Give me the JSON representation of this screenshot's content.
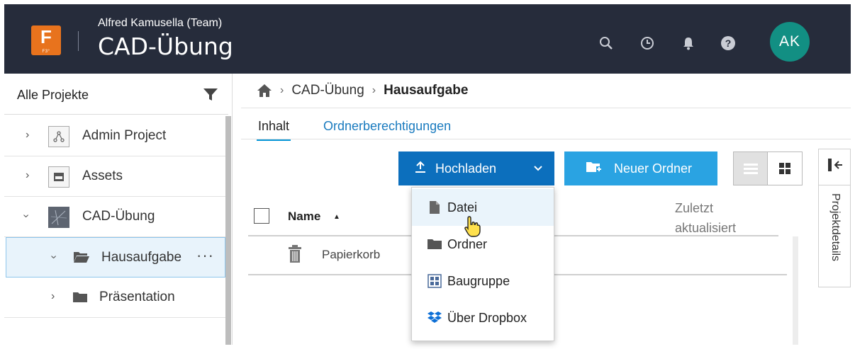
{
  "header": {
    "team_name": "Alfred Kamusella (Team)",
    "app_title": "CAD-Übung",
    "logo_letter": "F",
    "logo_sub": "F3°",
    "avatar_initials": "AK",
    "icons": [
      "search-icon",
      "history-icon",
      "bell-icon",
      "help-icon"
    ]
  },
  "sidebar": {
    "title": "Alle Projekte",
    "items": [
      {
        "label": "Admin Project",
        "icon": "project-admin-icon",
        "expanded": false
      },
      {
        "label": "Assets",
        "icon": "project-assets-icon",
        "expanded": false
      },
      {
        "label": "CAD-Übung",
        "icon": "project-cad-icon",
        "expanded": true
      },
      {
        "label": "Hausaufgabe",
        "icon": "folder-open-icon",
        "expanded": true,
        "selected": true,
        "more": "···"
      },
      {
        "label": "Präsentation",
        "icon": "folder-icon",
        "expanded": false
      }
    ]
  },
  "breadcrumb": {
    "items": [
      "CAD-Übung",
      "Hausaufgabe"
    ]
  },
  "tabs": {
    "content": "Inhalt",
    "permissions": "Ordnerberechtigungen"
  },
  "toolbar": {
    "upload_label": "Hochladen",
    "new_folder_label": "Neuer Ordner"
  },
  "table": {
    "col_name": "Name",
    "col_updated_line1": "Zuletzt",
    "col_updated_line2": "aktualisiert",
    "rows": [
      {
        "name": "Papierkorb",
        "icon": "trash-icon"
      }
    ]
  },
  "dropdown": {
    "items": [
      {
        "label": "Datei",
        "icon": "file-icon"
      },
      {
        "label": "Ordner",
        "icon": "folder-icon"
      },
      {
        "label": "Baugruppe",
        "icon": "assembly-icon"
      },
      {
        "label": "Über Dropbox",
        "icon": "dropbox-icon"
      }
    ]
  },
  "side_panel": {
    "label": "Projektdetails"
  },
  "colors": {
    "header_bg": "#262c3b",
    "upload_blue": "#0c6fbd",
    "folder_blue": "#2aa3e2",
    "avatar_teal": "#128f83",
    "logo_orange": "#e8731d"
  }
}
